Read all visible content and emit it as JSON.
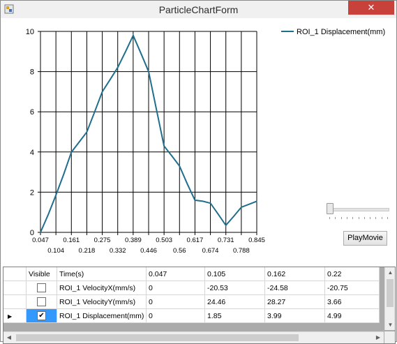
{
  "window": {
    "title": "ParticleChartForm",
    "close_glyph": "✕"
  },
  "chart_data": {
    "type": "line",
    "title": "",
    "xlabel": "",
    "ylabel": "",
    "xlim": [
      0.047,
      0.845
    ],
    "ylim": [
      0,
      10
    ],
    "grid": true,
    "legend_position": "top-right",
    "x_ticks_top_row": [
      "0.047",
      "0.161",
      "0.275",
      "0.389",
      "0.503",
      "0.617",
      "0.731",
      "0.845"
    ],
    "x_ticks_bottom_row": [
      "0.104",
      "0.218",
      "0.332",
      "0.446",
      "0.56",
      "0.674",
      "0.788"
    ],
    "y_ticks": [
      "0",
      "2",
      "4",
      "6",
      "8",
      "10"
    ],
    "series": [
      {
        "name": "ROI_1 Displacement(mm)",
        "color": "#1f6e8c",
        "x": [
          0.047,
          0.076,
          0.104,
          0.133,
          0.161,
          0.19,
          0.218,
          0.247,
          0.275,
          0.304,
          0.332,
          0.361,
          0.389,
          0.418,
          0.446,
          0.475,
          0.503,
          0.532,
          0.56,
          0.589,
          0.617,
          0.646,
          0.674,
          0.703,
          0.731,
          0.76,
          0.788,
          0.817,
          0.845
        ],
        "values": [
          0,
          0.9,
          1.85,
          2.9,
          3.99,
          4.5,
          4.99,
          6.0,
          7.0,
          7.6,
          8.2,
          9.0,
          9.8,
          8.9,
          8.0,
          6.1,
          4.3,
          3.8,
          3.3,
          2.4,
          1.6,
          1.55,
          1.45,
          0.9,
          0.35,
          0.8,
          1.25,
          1.4,
          1.55
        ]
      }
    ]
  },
  "controls": {
    "play_button": "PlayMovie",
    "slider_value": 0
  },
  "grid": {
    "headers": [
      "Visible",
      "Time(s)",
      "0.047",
      "0.105",
      "0.162",
      "0.22"
    ],
    "rows": [
      {
        "visible": false,
        "selected": false,
        "label": "ROI_1 VelocityX(mm/s)",
        "values": [
          "0",
          "-20.53",
          "-24.58",
          "-20.75"
        ]
      },
      {
        "visible": false,
        "selected": false,
        "label": "ROI_1 VelocityY(mm/s)",
        "values": [
          "0",
          "24.46",
          "28.27",
          "3.66"
        ]
      },
      {
        "visible": true,
        "selected": true,
        "label": "ROI_1 Displacement(mm)",
        "values": [
          "0",
          "1.85",
          "3.99",
          "4.99"
        ]
      }
    ],
    "current_row_glyph": "▶",
    "check_glyph": "✔"
  },
  "scrollbars": {
    "up": "▲",
    "down": "▼",
    "left": "◀",
    "right": "▶"
  }
}
